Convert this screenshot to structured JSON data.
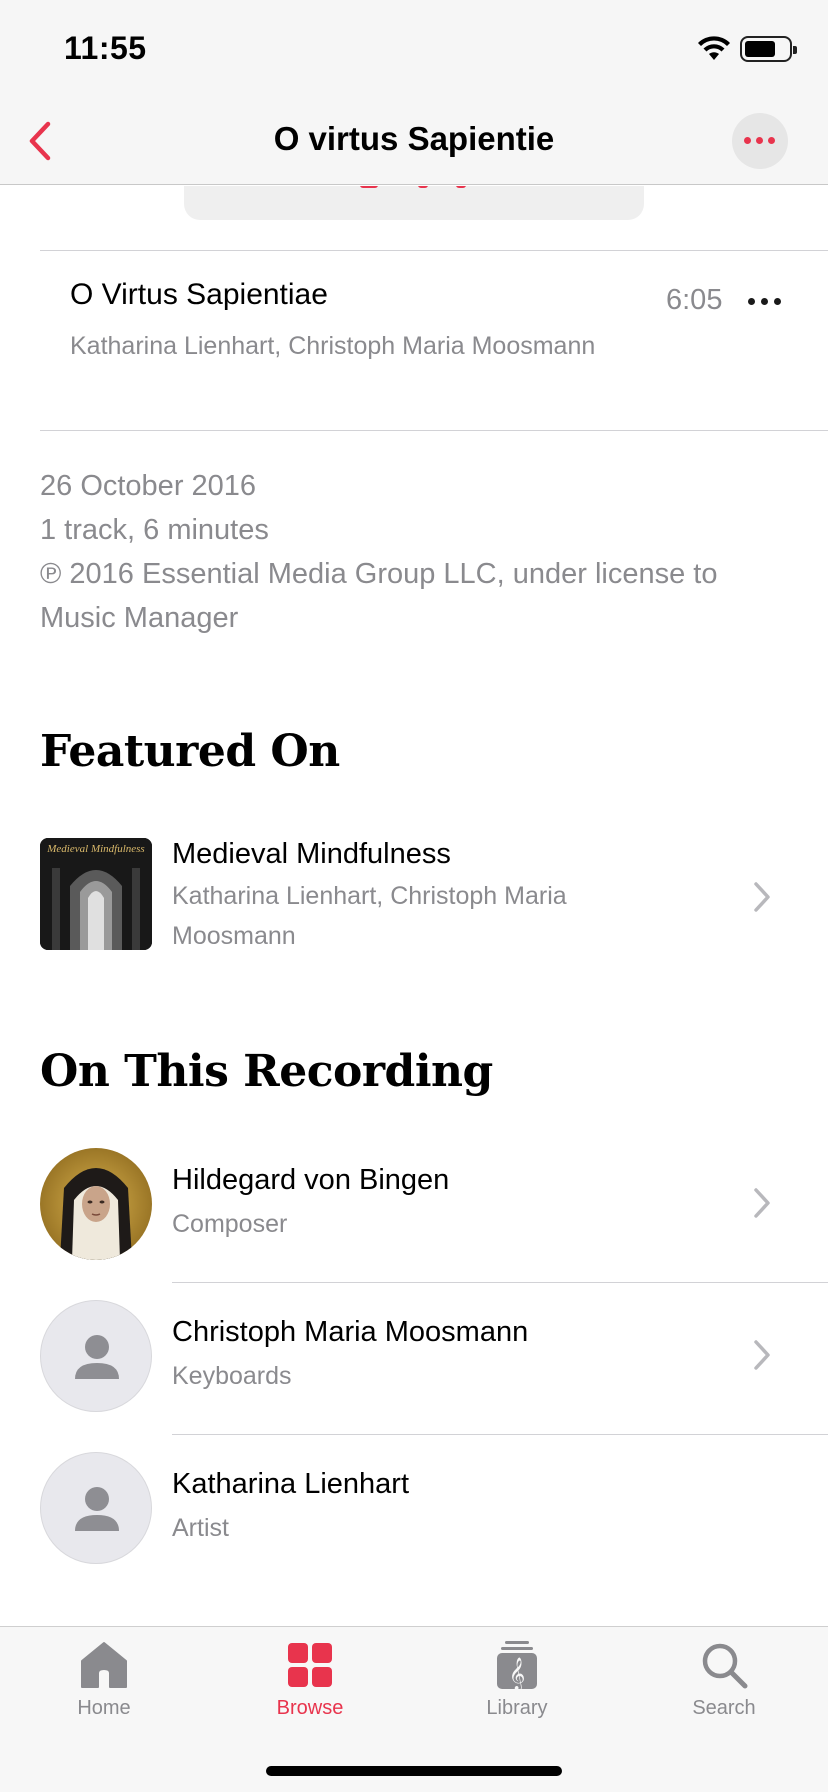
{
  "status_bar": {
    "time": "11:55"
  },
  "nav": {
    "title": "O virtus Sapientie"
  },
  "track": {
    "title": "O Virtus Sapientiae",
    "artists": "Katharina Lienhart, Christoph Maria Moosmann",
    "duration": "6:05"
  },
  "meta": {
    "release_date": "26 October 2016",
    "track_info": "1 track, 6 minutes",
    "copyright": "℗ 2016 Essential Media Group LLC, under license to Music Manager"
  },
  "featured": {
    "heading": "Featured On",
    "album": {
      "title": "Medieval Mindfulness",
      "artists": "Katharina Lienhart, Christoph Maria Moosmann",
      "art_text": "Medieval Mindfulness"
    }
  },
  "recording": {
    "heading": "On This Recording",
    "people": [
      {
        "name": "Hildegard von Bingen",
        "role": "Composer"
      },
      {
        "name": "Christoph Maria Moosmann",
        "role": "Keyboards"
      },
      {
        "name": "Katharina Lienhart",
        "role": "Artist"
      }
    ]
  },
  "tabs": [
    {
      "label": "Home",
      "icon": "home-icon",
      "active": false
    },
    {
      "label": "Browse",
      "icon": "browse-icon",
      "active": true
    },
    {
      "label": "Library",
      "icon": "library-icon",
      "active": false
    },
    {
      "label": "Search",
      "icon": "search-icon",
      "active": false
    }
  ],
  "colors": {
    "accent": "#e8344d",
    "secondary_text": "#8a8a8e",
    "bar_bg": "#f6f6f6"
  }
}
